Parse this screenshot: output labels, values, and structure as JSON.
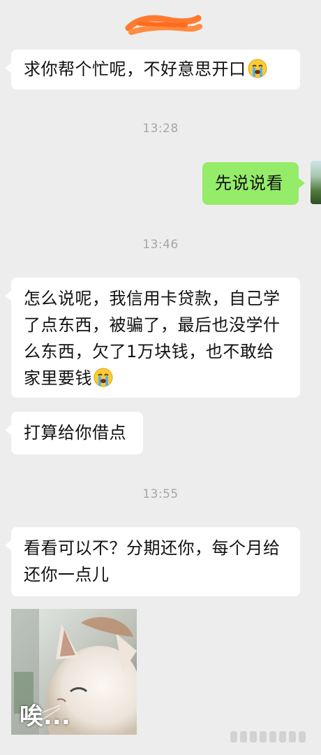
{
  "header": {
    "title_icon": "redacted-name-scribble"
  },
  "messages": [
    {
      "id": "m1",
      "side": "left",
      "text": "求你帮个忙呢，不好意思开口",
      "emoji": "crying-face-emoji"
    },
    {
      "id": "t1",
      "type": "time",
      "text": "13:28"
    },
    {
      "id": "m2",
      "side": "right",
      "text": "先说说看"
    },
    {
      "id": "t2",
      "type": "time",
      "text": "13:46"
    },
    {
      "id": "m3",
      "side": "left",
      "lines": [
        "怎么说呢，我信用卡贷款，自己学",
        "了点东西，被骗了，最后也没学什",
        "么东西，欠了1万块钱，也不敢给",
        "家里要钱"
      ],
      "emoji": "crying-face-emoji"
    },
    {
      "id": "m4",
      "side": "left",
      "text": "打算给你借点"
    },
    {
      "id": "t3",
      "type": "time",
      "text": "13:55"
    },
    {
      "id": "m5",
      "side": "left",
      "lines": [
        "看看可以不？分期还你，每个月给",
        "还你一点儿"
      ]
    },
    {
      "id": "m6",
      "side": "left",
      "type": "sticker",
      "caption": "唉...",
      "sticker_icon": "sad-cat-sticker"
    }
  ],
  "colors": {
    "background": "#ededed",
    "left_bubble": "#ffffff",
    "right_bubble": "#95ec69",
    "timestamp": "#a6a6a6",
    "redaction": "#ff7a2e"
  }
}
